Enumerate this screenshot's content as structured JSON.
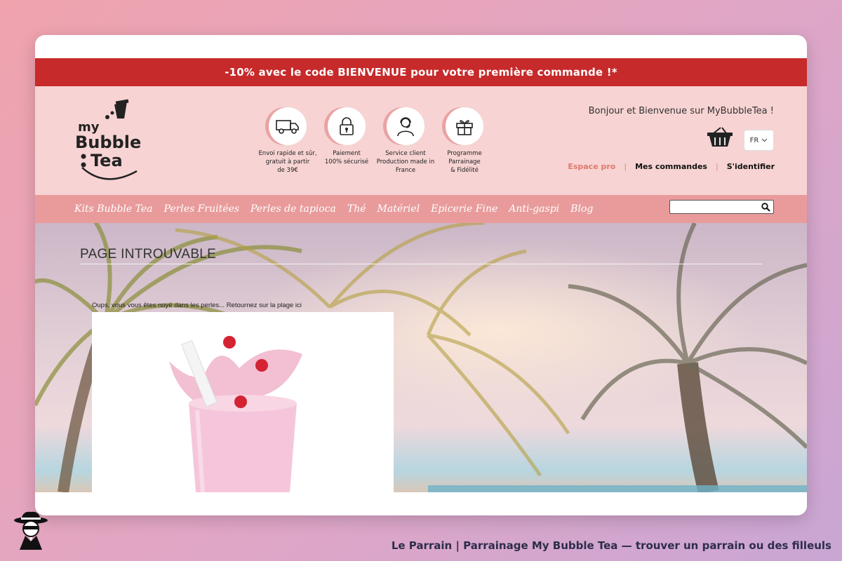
{
  "promo": {
    "text": "-10% avec le code BIENVENUE pour votre première commande !*"
  },
  "logo": {
    "line1": "my",
    "line2": "Bubble",
    "line3": "Tea"
  },
  "features": [
    {
      "icon": "truck-icon",
      "text": "Envoi rapide et sûr,\ngratuit à partir\nde 39€"
    },
    {
      "icon": "padlock-icon",
      "text": "Paiement\n100% sécurisé"
    },
    {
      "icon": "support-agent-icon",
      "text": "Service client\nProduction made in\nFrance"
    },
    {
      "icon": "gift-icon",
      "text": "Programme Parrainage\n& Fidélité"
    }
  ],
  "header": {
    "welcome": "Bonjour et Bienvenue sur MyBubbleTea !",
    "language": "FR",
    "links": {
      "pro": "Espace pro",
      "orders": "Mes commandes",
      "login": "S'identifier"
    }
  },
  "nav": {
    "items": [
      "Kits Bubble Tea",
      "Perles Fruitées",
      "Perles de tapioca",
      "Thé",
      "Matériel",
      "Epicerie Fine",
      "Anti-gaspi",
      "Blog"
    ]
  },
  "search": {
    "placeholder": ""
  },
  "content": {
    "title": "PAGE INTROUVABLE",
    "message": "Oups, vous vous êtes noyé dans les perles... Retournez sur la plage ici"
  },
  "footer": {
    "caption": "Le Parrain | Parrainage My Bubble Tea — trouver un parrain ou des filleuls"
  },
  "colors": {
    "promo_bg": "#c62a2a",
    "header_bg": "#f7d3d3",
    "nav_bg": "#e99b9b",
    "pro_link": "#e07a6a"
  }
}
